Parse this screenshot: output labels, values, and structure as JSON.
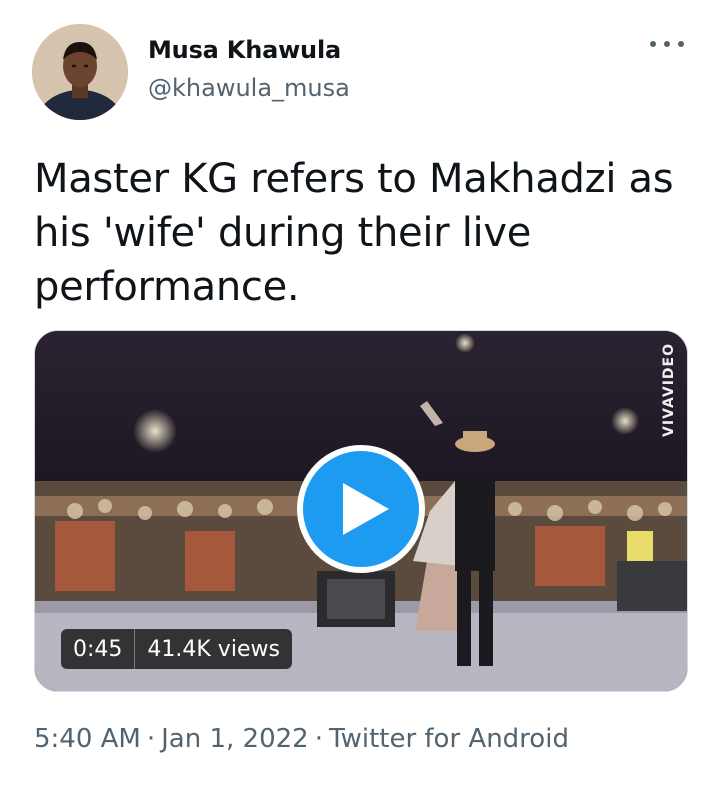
{
  "author": {
    "name": "Musa Khawula",
    "handle": "@khawula_musa"
  },
  "tweet": {
    "text": "Master KG refers to Makhadzi as his 'wife' during their live performance."
  },
  "media": {
    "watermark": "VIVAVIDEO",
    "duration": "0:45",
    "views": "41.4K views"
  },
  "footer": {
    "time": "5:40 AM",
    "separator": "·",
    "date": "Jan 1, 2022",
    "source": "Twitter for Android"
  },
  "colors": {
    "accent": "#1d9bf0",
    "secondary_text": "#536471",
    "primary_text": "#0f1419"
  },
  "icons": {
    "more": "more-horizontal-icon",
    "play": "play-icon"
  }
}
